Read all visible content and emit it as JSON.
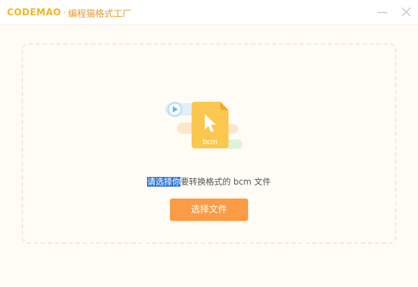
{
  "titlebar": {
    "logo_text": "CODEMAO",
    "separator": "·",
    "app_name": "编程猫格式工厂",
    "minimize_icon": "minimize-icon",
    "close_icon": "close-icon"
  },
  "illustration": {
    "file_label": "bcm",
    "icons": [
      "play-icon",
      "file-icon",
      "cursor-icon"
    ]
  },
  "hint": {
    "selected_part": "请选择你",
    "rest_part": "要转换格式的",
    "format": "bcm",
    "suffix": "文件"
  },
  "choose_button": {
    "label": "选择文件"
  },
  "colors": {
    "brand_yellow": "#f4b51c",
    "brand_orange": "#e89a2e",
    "button_orange": "#fb9b45",
    "file_yellow": "#fbc74f",
    "selection_blue": "#2f78d1",
    "background": "#fffcf5"
  }
}
